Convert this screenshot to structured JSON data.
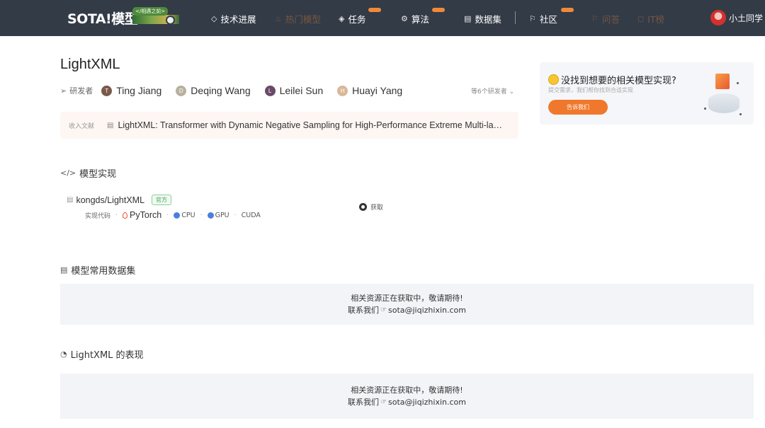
{
  "nav": {
    "logo_text": "SOTA!模型",
    "logo_tag": "</相遇之前>",
    "items": [
      {
        "label": "技术进展",
        "icon": "cube-icon"
      },
      {
        "label": "热门模型",
        "icon": "fire-icon"
      },
      {
        "label": "任务",
        "icon": "layers-icon"
      },
      {
        "label": "算法",
        "icon": "gear-icon"
      },
      {
        "label": "数据集",
        "icon": "database-icon"
      },
      {
        "label": "社区",
        "icon": "flag-icon"
      },
      {
        "label": "问答",
        "icon": "flag-icon"
      },
      {
        "label": "IT榜",
        "icon": "chat-icon"
      }
    ],
    "user_name": "小土同学",
    "colors": {
      "bar": "#333b47",
      "accent": "#f08a3a"
    }
  },
  "model": {
    "title": "LightXML",
    "publisher_label": "研发者",
    "authors": [
      {
        "name": "Ting Jiang",
        "initial": "T",
        "color": "#7a5a4a"
      },
      {
        "name": "Deqing Wang",
        "initial": "D",
        "color": "#b8b0a0"
      },
      {
        "name": "Leilei Sun",
        "initial": "L",
        "color": "#6a4a66"
      },
      {
        "name": "Huayi Yang",
        "initial": "H",
        "color": "#d8b898"
      }
    ],
    "more_authors": "等6个研发者",
    "citation_label": "收入文献",
    "citation": "LightXML: Transformer with Dynamic Negative Sampling for High-Performance Extreme Multi-label Text Classification"
  },
  "implementation": {
    "heading": "模型实现",
    "repo": "kongds/LightXML",
    "official_badge": "官方",
    "framework_label": "实现代码",
    "framework": "PyTorch",
    "hardware": [
      "CPU",
      "GPU",
      "CUDA"
    ],
    "get_button": "获取"
  },
  "datasets": {
    "heading": "模型常用数据集",
    "empty_line1": "相关资源正在获取中，敬请期待!",
    "contact_label": "联系我们",
    "email": "sota@jiqizhixin.com"
  },
  "performance": {
    "heading": "LightXML 的表现",
    "empty_line1": "相关资源正在获取中，敬请期待!",
    "contact_label": "联系我们",
    "email": "sota@jiqizhixin.com"
  },
  "ad": {
    "title": "没找到想要的相关模型实现?",
    "subtitle": "提交需求，我们帮你找到合适实现",
    "button": "告诉我们"
  }
}
